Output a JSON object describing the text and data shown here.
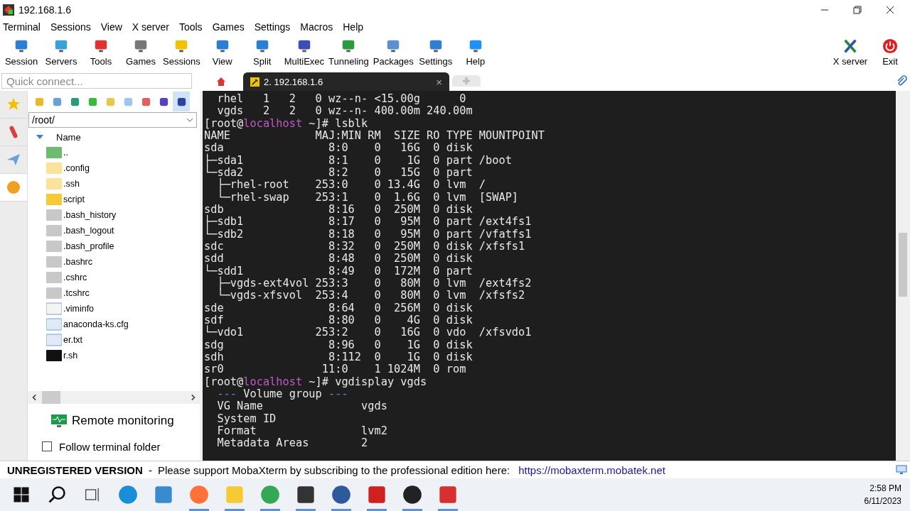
{
  "window": {
    "title": "192.168.1.6"
  },
  "menu": [
    "Terminal",
    "Sessions",
    "View",
    "X server",
    "Tools",
    "Games",
    "Settings",
    "Macros",
    "Help"
  ],
  "toolbar": [
    "Session",
    "Servers",
    "Tools",
    "Games",
    "Sessions",
    "View",
    "Split",
    "MultiExec",
    "Tunneling",
    "Packages",
    "Settings",
    "Help"
  ],
  "toolbar_right": [
    "X server",
    "Exit"
  ],
  "quick_connect": {
    "placeholder": "Quick connect..."
  },
  "tabs": [
    {
      "kind": "home",
      "selected": false
    },
    {
      "kind": "session",
      "label": "2. 192.168.1.6",
      "close": "×",
      "selected": true
    },
    {
      "kind": "new",
      "selected": false
    }
  ],
  "side_tabs": [
    {
      "kind": "star",
      "selected": false
    },
    {
      "kind": "tools",
      "selected": false
    },
    {
      "kind": "send",
      "selected": false
    },
    {
      "kind": "sftp",
      "selected": true
    }
  ],
  "file_tools": [
    {
      "kind": "up",
      "selected": false
    },
    {
      "kind": "download",
      "selected": false
    },
    {
      "kind": "upload",
      "selected": false
    },
    {
      "kind": "refresh",
      "selected": false
    },
    {
      "kind": "newfolder",
      "selected": false
    },
    {
      "kind": "newfile",
      "selected": false
    },
    {
      "kind": "delete",
      "selected": false
    },
    {
      "kind": "rename",
      "selected": false
    },
    {
      "kind": "follow",
      "selected": true
    }
  ],
  "path": "/root/",
  "file_list": {
    "column": "Name",
    "files": [
      {
        "name": "..",
        "kind": "up"
      },
      {
        "name": ".config",
        "kind": "folder-light"
      },
      {
        "name": ".ssh",
        "kind": "folder-light"
      },
      {
        "name": "script",
        "kind": "folder"
      },
      {
        "name": ".bash_history",
        "kind": "file-gray"
      },
      {
        "name": ".bash_logout",
        "kind": "file-gray"
      },
      {
        "name": ".bash_profile",
        "kind": "file-gray"
      },
      {
        "name": ".bashrc",
        "kind": "file-gray"
      },
      {
        "name": ".cshrc",
        "kind": "file-gray"
      },
      {
        "name": ".tcshrc",
        "kind": "file-gray"
      },
      {
        "name": ".viminfo",
        "kind": "file-blank"
      },
      {
        "name": "anaconda-ks.cfg",
        "kind": "file-edit"
      },
      {
        "name": "er.txt",
        "kind": "file-text"
      },
      {
        "name": "r.sh",
        "kind": "terminal"
      }
    ]
  },
  "remote_monitoring": "Remote monitoring",
  "follow_folder": {
    "label": "Follow terminal folder",
    "checked": false
  },
  "terminal": [
    {
      "kind": "plain",
      "text": "  rhel   1   2   0 wz--n- <15.00g      0"
    },
    {
      "kind": "plain",
      "text": "  vgds   2   2   0 wz--n- 400.00m 240.00m"
    },
    {
      "kind": "prompt",
      "before": "[root@",
      "host": "localhost",
      "after": " ~]# lsblk"
    },
    {
      "kind": "plain",
      "text": "NAME             MAJ:MIN RM  SIZE RO TYPE MOUNTPOINT"
    },
    {
      "kind": "plain",
      "text": "sda                8:0    0   16G  0 disk"
    },
    {
      "kind": "plain",
      "text": "├─sda1             8:1    0    1G  0 part /boot"
    },
    {
      "kind": "plain",
      "text": "└─sda2             8:2    0   15G  0 part"
    },
    {
      "kind": "plain",
      "text": "  ├─rhel-root    253:0    0 13.4G  0 lvm  /"
    },
    {
      "kind": "plain",
      "text": "  └─rhel-swap    253:1    0  1.6G  0 lvm  [SWAP]"
    },
    {
      "kind": "plain",
      "text": "sdb                8:16   0  250M  0 disk"
    },
    {
      "kind": "plain",
      "text": "├─sdb1             8:17   0   95M  0 part /ext4fs1"
    },
    {
      "kind": "plain",
      "text": "└─sdb2             8:18   0   95M  0 part /vfatfs1"
    },
    {
      "kind": "plain",
      "text": "sdc                8:32   0  250M  0 disk /xfsfs1"
    },
    {
      "kind": "plain",
      "text": "sdd                8:48   0  250M  0 disk"
    },
    {
      "kind": "plain",
      "text": "└─sdd1             8:49   0  172M  0 part"
    },
    {
      "kind": "plain",
      "text": "  ├─vgds-ext4vol 253:3    0   80M  0 lvm  /ext4fs2"
    },
    {
      "kind": "plain",
      "text": "  └─vgds-xfsvol  253:4    0   80M  0 lvm  /xfsfs2"
    },
    {
      "kind": "plain",
      "text": "sde                8:64   0  256M  0 disk"
    },
    {
      "kind": "plain",
      "text": "sdf                8:80   0    4G  0 disk"
    },
    {
      "kind": "plain",
      "text": "└─vdo1           253:2    0   16G  0 vdo  /xfsvdo1"
    },
    {
      "kind": "plain",
      "text": "sdg                8:96   0    1G  0 disk"
    },
    {
      "kind": "plain",
      "text": "sdh                8:112  0    1G  0 disk"
    },
    {
      "kind": "plain",
      "text": "sr0               11:0    1 1024M  0 rom"
    },
    {
      "kind": "prompt",
      "before": "[root@",
      "host": "localhost",
      "after": " ~]# vgdisplay vgds"
    },
    {
      "kind": "section",
      "dash_left": "---",
      "title": "Volume group",
      "dash_right": "---"
    },
    {
      "kind": "plain",
      "text": "  VG Name               vgds"
    },
    {
      "kind": "plain",
      "text": "  System ID"
    },
    {
      "kind": "plain",
      "text": "  Format                lvm2"
    },
    {
      "kind": "plain",
      "text": "  Metadata Areas        2"
    }
  ],
  "status_bar": {
    "label": "UNREGISTERED VERSION",
    "separator": "-",
    "message": "Please support MobaXterm by subscribing to the professional edition here:",
    "link": "https://mobaxterm.mobatek.net"
  },
  "taskbar": {
    "apps": [
      {
        "kind": "edge",
        "running": false
      },
      {
        "kind": "photos",
        "running": false
      },
      {
        "kind": "firefox",
        "running": true
      },
      {
        "kind": "explorer",
        "running": true
      },
      {
        "kind": "chrome",
        "running": true
      },
      {
        "kind": "obs",
        "running": true
      },
      {
        "kind": "virtualbox",
        "running": true
      },
      {
        "kind": "redapp",
        "running": true
      },
      {
        "kind": "mobaxterm",
        "running": true
      },
      {
        "kind": "pdf",
        "running": true
      }
    ],
    "time": "2:58 PM",
    "date": "6/11/2023"
  }
}
